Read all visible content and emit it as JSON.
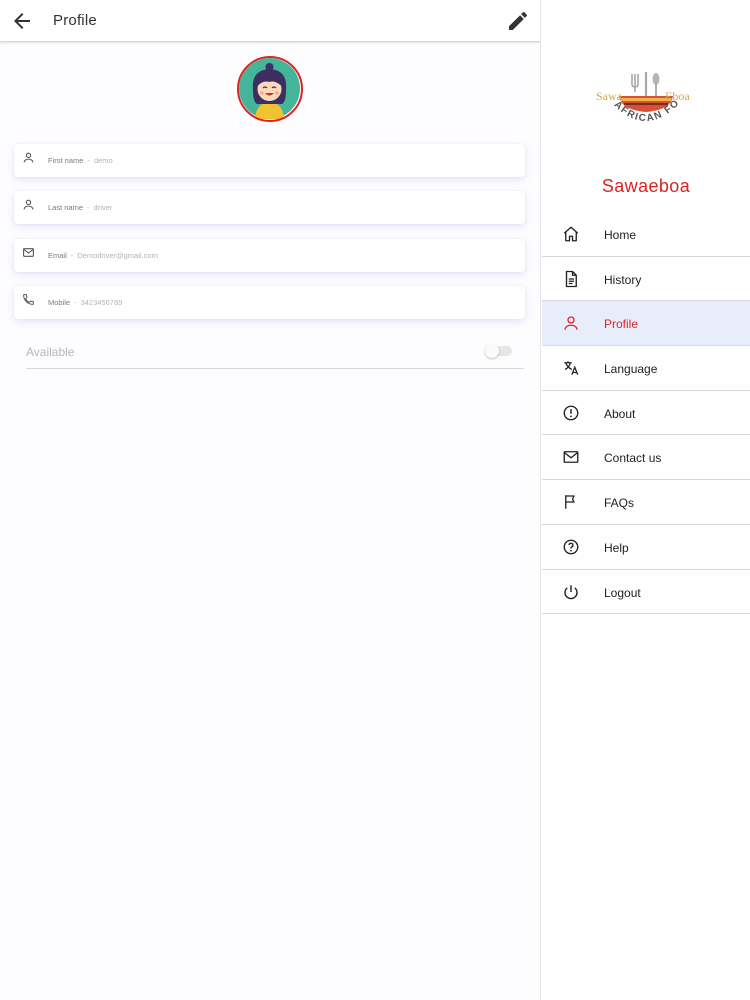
{
  "appbar": {
    "title": "Profile"
  },
  "profile": {
    "fields": [
      {
        "label": "First name",
        "value": "demo"
      },
      {
        "label": "Last name",
        "value": "driver"
      },
      {
        "label": "Email",
        "value": "Demodriver@gmail.com"
      },
      {
        "label": "Mobile",
        "value": "3423456789"
      }
    ],
    "available": {
      "label": "Available",
      "on": false
    }
  },
  "drawer": {
    "logo": {
      "word_left": "Sawa",
      "word_right": "Eboa",
      "arc_text": "AFRICAN FOODS"
    },
    "brand_name": "Sawaeboa",
    "items": [
      {
        "label": "Home",
        "icon": "home-icon"
      },
      {
        "label": "History",
        "icon": "document-icon"
      },
      {
        "label": "Profile",
        "icon": "person-icon",
        "active": true
      },
      {
        "label": "Language",
        "icon": "translate-icon"
      },
      {
        "label": "About",
        "icon": "info-icon"
      },
      {
        "label": "Contact us",
        "icon": "mail-icon"
      },
      {
        "label": "FAQs",
        "icon": "flag-icon"
      },
      {
        "label": "Help",
        "icon": "help-icon"
      },
      {
        "label": "Logout",
        "icon": "power-icon"
      }
    ]
  },
  "colors": {
    "accent": "#e02424",
    "active_bg": "#e7edfb",
    "divider": "#d9d9d9"
  }
}
